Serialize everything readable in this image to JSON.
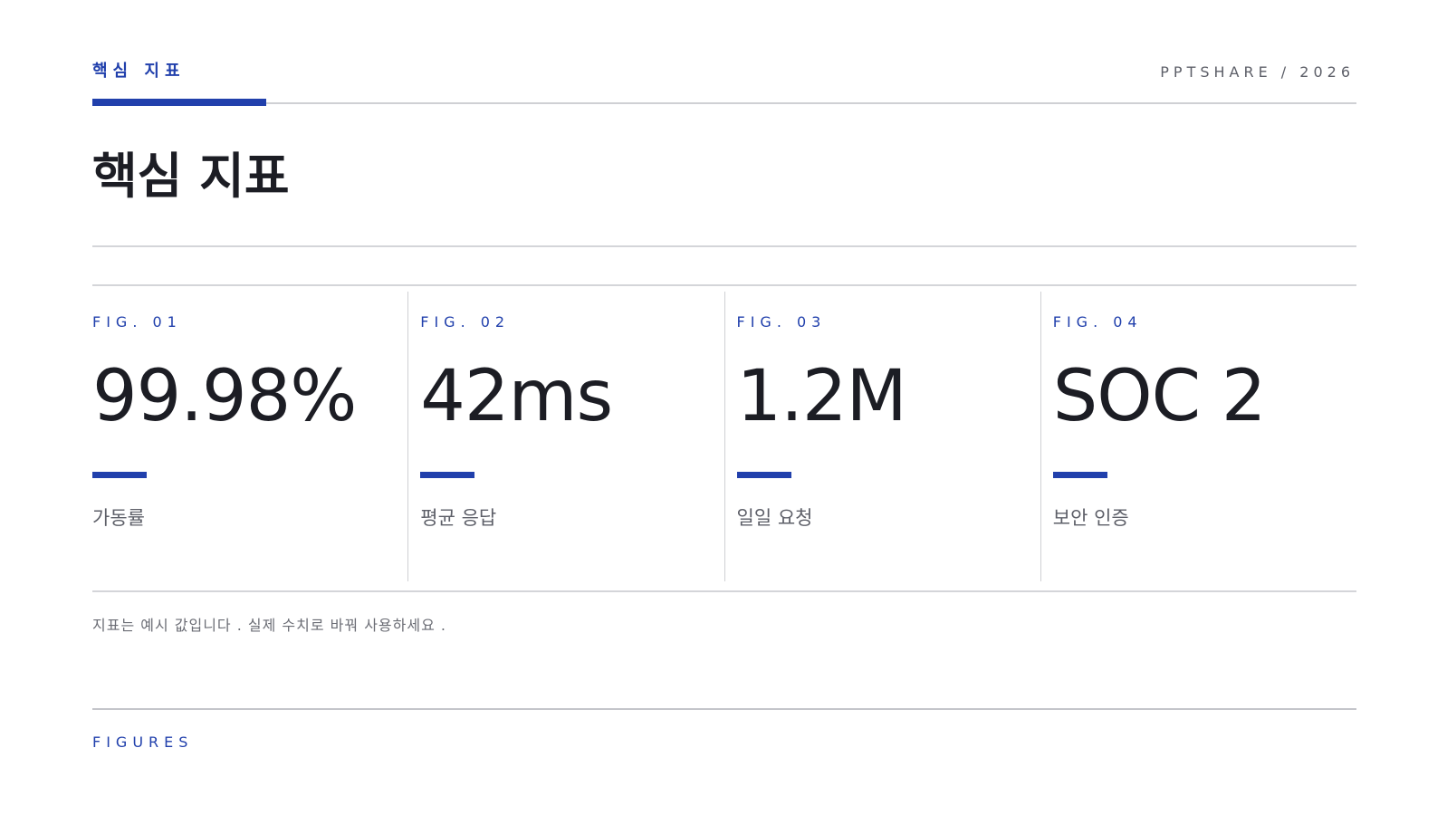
{
  "header": {
    "eyebrow": "핵심 지표",
    "brand": "PPTSHARE / 2026"
  },
  "title": "핵심 지표",
  "metrics": [
    {
      "fig": "FIG. 01",
      "value": "99.98%",
      "label": "가동률"
    },
    {
      "fig": "FIG. 02",
      "value": "42ms",
      "label": "평균 응답"
    },
    {
      "fig": "FIG. 03",
      "value": "1.2M",
      "label": "일일 요청"
    },
    {
      "fig": "FIG. 04",
      "value": "SOC 2",
      "label": "보안 인증"
    }
  ],
  "note": "지표는 예시 값입니다 . 실제 수치로 바꿔 사용하세요 .",
  "footer": "FIGURES",
  "colors": {
    "accent": "#2140ac",
    "text": "#1c1d24",
    "muted": "#5d5f68",
    "rule": "#cfd0d4"
  }
}
